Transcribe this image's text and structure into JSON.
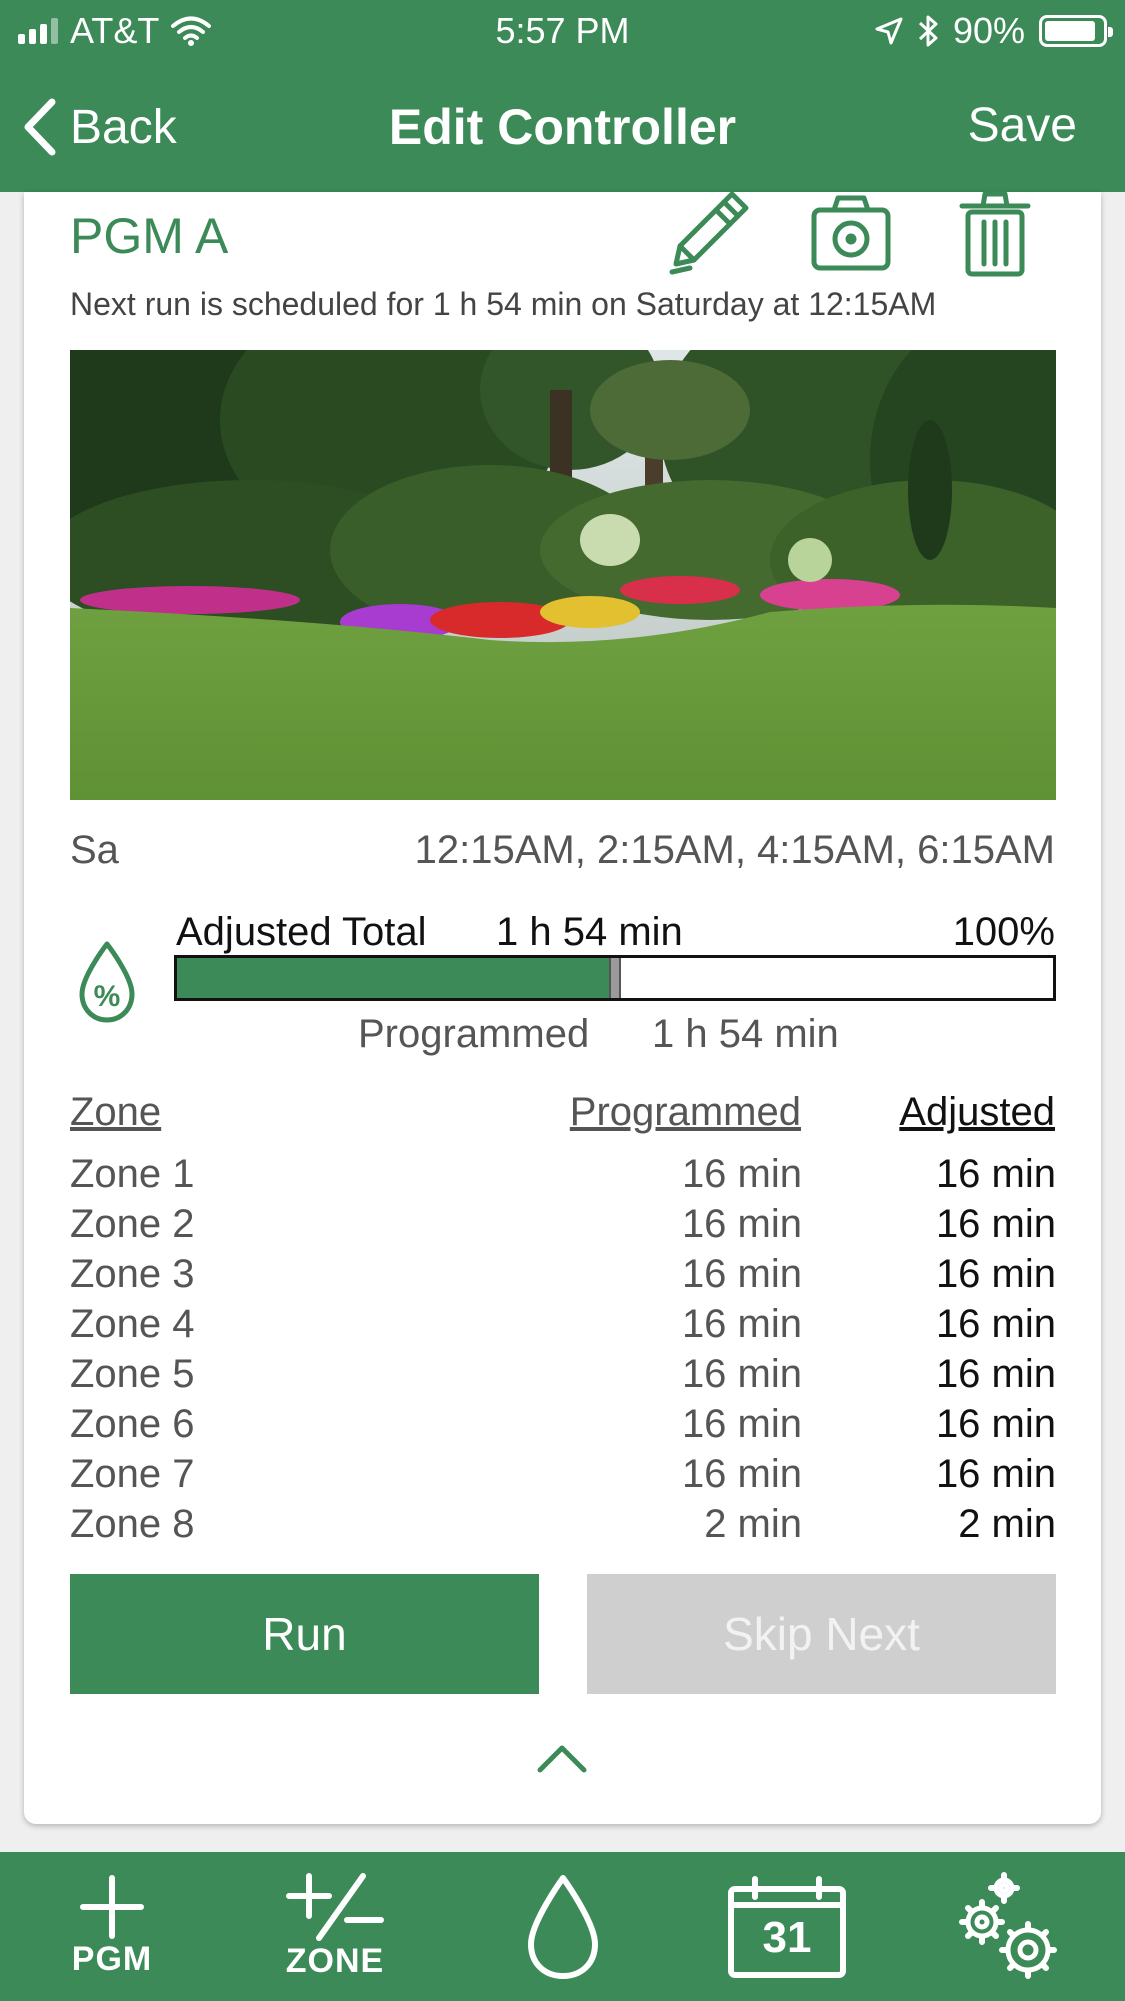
{
  "status": {
    "carrier": "AT&T",
    "time": "5:57 PM",
    "battery": "90%",
    "battery_level": 0.9
  },
  "nav": {
    "back_label": "Back",
    "title": "Edit Controller",
    "save_label": "Save"
  },
  "program": {
    "name": "PGM A",
    "next_run": "Next run is scheduled for 1 h 54 min on Saturday at 12:15AM",
    "photo_icon": "garden-photo"
  },
  "schedule": {
    "day": "Sa",
    "times": "12:15AM, 2:15AM, 4:15AM, 6:15AM"
  },
  "adjustment": {
    "adjusted_label": "Adjusted Total",
    "adjusted_total": "1 h 54 min",
    "percent": "100%",
    "programmed_label": "Programmed",
    "programmed_total": "1 h 54 min",
    "bar_fill_fraction": 0.5
  },
  "zones": {
    "headers": {
      "zone": "Zone",
      "programmed": "Programmed",
      "adjusted": "Adjusted"
    },
    "rows": [
      {
        "name": "Zone 1",
        "programmed": "16 min",
        "adjusted": "16 min"
      },
      {
        "name": "Zone 2",
        "programmed": "16 min",
        "adjusted": "16 min"
      },
      {
        "name": "Zone 3",
        "programmed": "16 min",
        "adjusted": "16 min"
      },
      {
        "name": "Zone 4",
        "programmed": "16 min",
        "adjusted": "16 min"
      },
      {
        "name": "Zone 5",
        "programmed": "16 min",
        "adjusted": "16 min"
      },
      {
        "name": "Zone 6",
        "programmed": "16 min",
        "adjusted": "16 min"
      },
      {
        "name": "Zone 7",
        "programmed": "16 min",
        "adjusted": "16 min"
      },
      {
        "name": "Zone 8",
        "programmed": "2 min",
        "adjusted": "2 min"
      }
    ]
  },
  "actions": {
    "run_label": "Run",
    "skip_label": "Skip Next"
  },
  "tabs": {
    "pgm_label": "PGM",
    "zone_label": "ZONE",
    "calendar_day": "31"
  },
  "colors": {
    "brand_green": "#3b8a57",
    "disabled_gray": "#cfcfcf"
  }
}
